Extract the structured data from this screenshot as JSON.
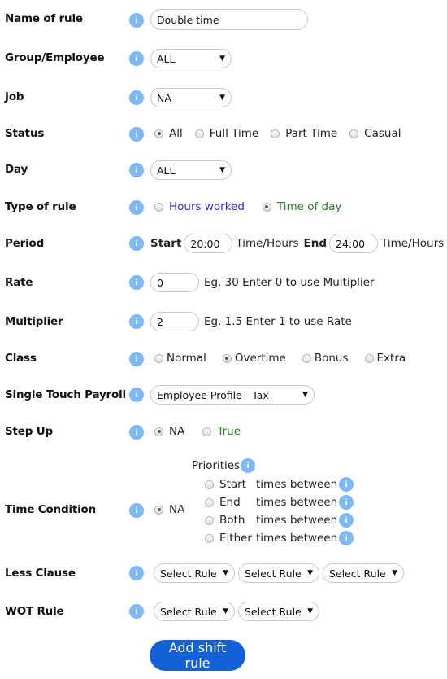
{
  "form": {
    "name_of_rule": {
      "label": "Name of rule",
      "value": "Double time"
    },
    "group_employee": {
      "label": "Group/Employee",
      "value": "ALL"
    },
    "job": {
      "label": "Job",
      "value": "NA"
    },
    "status": {
      "label": "Status",
      "options": [
        "All",
        "Full Time",
        "Part Time",
        "Casual"
      ],
      "selected": "All"
    },
    "day": {
      "label": "Day",
      "value": "ALL"
    },
    "type_of_rule": {
      "label": "Type of rule",
      "options": [
        "Hours worked",
        "Time of day"
      ],
      "selected": "Time of day",
      "colors": {
        "hours_worked": "#2b2bd6",
        "time_of_day": "#2a7a2a"
      }
    },
    "period": {
      "label": "Period",
      "start_label": "Start",
      "start_value": "20:00",
      "start_unit": "Time/Hours",
      "end_label": "End",
      "end_value": "24:00",
      "end_unit": "Time/Hours"
    },
    "rate": {
      "label": "Rate",
      "value": "0",
      "hint": "Eg. 30 Enter 0 to use Multiplier"
    },
    "multiplier": {
      "label": "Multiplier",
      "value": "2",
      "hint": "Eg. 1.5 Enter 1 to use Rate"
    },
    "class": {
      "label": "Class",
      "options": [
        "Normal",
        "Overtime",
        "Bonus",
        "Extra"
      ],
      "selected": "Overtime"
    },
    "single_touch_payroll": {
      "label": "Single Touch Payroll",
      "value": "Employee Profile - Tax"
    },
    "step_up": {
      "label": "Step Up",
      "options": [
        "NA",
        "True"
      ],
      "selected": "NA"
    },
    "time_condition": {
      "label": "Time Condition",
      "na_label": "NA",
      "priorities_label": "Priorities",
      "priorities": [
        {
          "label": "Start",
          "suffix": "times between"
        },
        {
          "label": "End",
          "suffix": "times between"
        },
        {
          "label": "Both",
          "suffix": "times between"
        },
        {
          "label": "Either",
          "suffix": "times between"
        }
      ]
    },
    "less_clause": {
      "label": "Less Clause",
      "selects": [
        "Select Rule",
        "Select Rule",
        "Select Rule"
      ]
    },
    "wot_rule": {
      "label": "WOT Rule",
      "selects": [
        "Select Rule",
        "Select Rule"
      ]
    }
  },
  "info_icon_glyph": "i",
  "caret_glyph": "▼",
  "submit_label": "Add shift rule",
  "colors": {
    "info": "#7fb8f7",
    "button": "#1360d8"
  }
}
